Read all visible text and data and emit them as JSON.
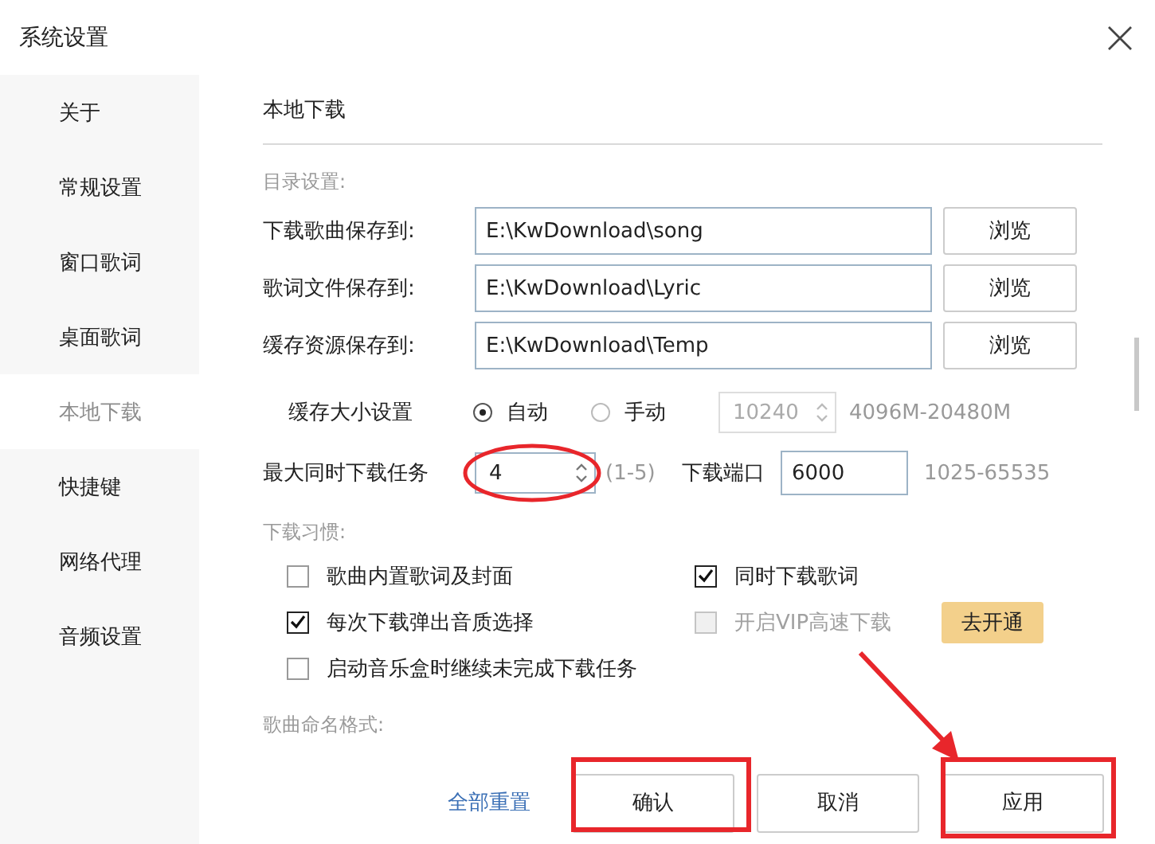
{
  "window": {
    "title": "系统设置"
  },
  "sidebar": {
    "items": [
      {
        "label": "关于",
        "selected": false
      },
      {
        "label": "常规设置",
        "selected": false
      },
      {
        "label": "窗口歌词",
        "selected": false
      },
      {
        "label": "桌面歌词",
        "selected": false
      },
      {
        "label": "本地下载",
        "selected": true
      },
      {
        "label": "快捷键",
        "selected": false
      },
      {
        "label": "网络代理",
        "selected": false
      },
      {
        "label": "音频设置",
        "selected": false
      }
    ]
  },
  "page": {
    "title": "本地下载"
  },
  "directory": {
    "heading": "目录设置:",
    "rows": [
      {
        "label": "下载歌曲保存到:",
        "value": "E:\\KwDownload\\song",
        "button": "浏览"
      },
      {
        "label": "歌词文件保存到:",
        "value": "E:\\KwDownload\\Lyric",
        "button": "浏览"
      },
      {
        "label": "缓存资源保存到:",
        "value": "E:\\KwDownload\\Temp",
        "button": "浏览"
      }
    ]
  },
  "cache": {
    "label": "缓存大小设置",
    "options": [
      {
        "label": "自动",
        "selected": true
      },
      {
        "label": "手动",
        "selected": false
      }
    ],
    "size": {
      "value": "10240",
      "disabled": true
    },
    "range": "4096M-20480M"
  },
  "tasks": {
    "label": "最大同时下载任务",
    "value": "4",
    "range": "(1-5)"
  },
  "port": {
    "label": "下载端口",
    "value": "6000",
    "range": "1025-65535"
  },
  "habits": {
    "heading": "下载习惯:",
    "options": [
      {
        "label": "歌曲内置歌词及封面",
        "checked": false,
        "disabled": false
      },
      {
        "label": "同时下载歌词",
        "checked": true,
        "disabled": false
      },
      {
        "label": "每次下载弹出音质选择",
        "checked": true,
        "disabled": false
      },
      {
        "label": "开启VIP高速下载",
        "checked": false,
        "disabled": true
      },
      {
        "label": "启动音乐盒时继续未完成下载任务",
        "checked": false,
        "disabled": false
      }
    ],
    "vip_button": "去开通"
  },
  "naming": {
    "heading": "歌曲命名格式:"
  },
  "footer": {
    "reset": "全部重置",
    "buttons": [
      "确认",
      "取消",
      "应用"
    ]
  }
}
